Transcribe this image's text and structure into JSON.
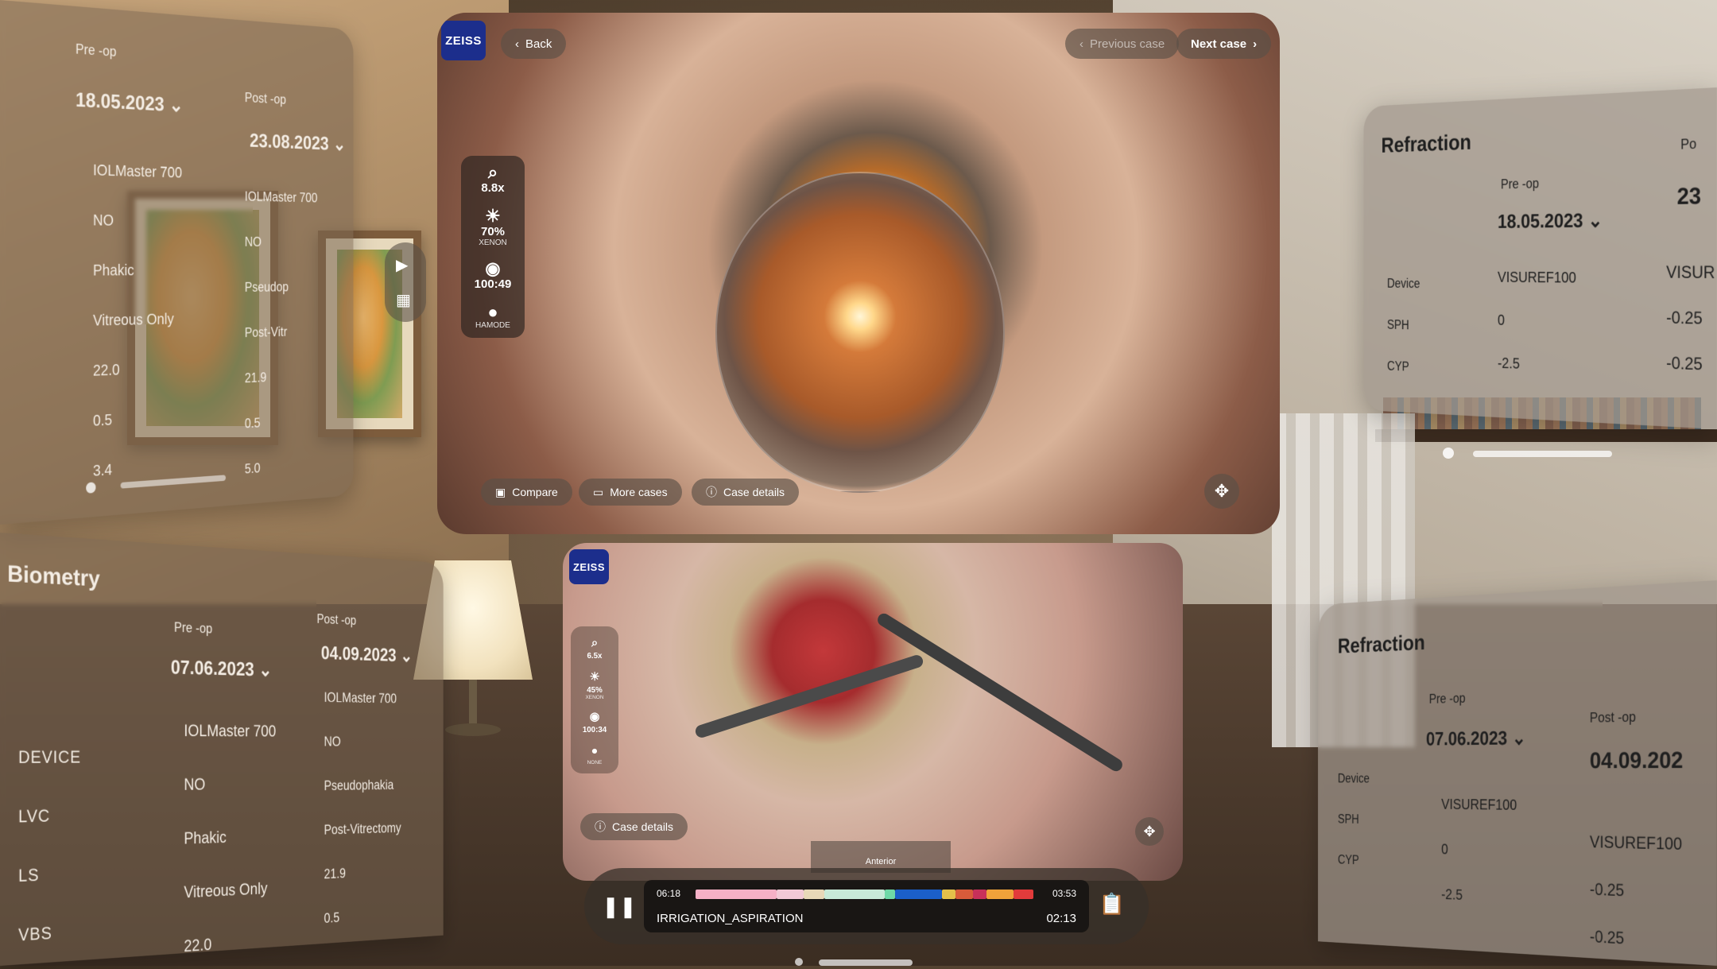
{
  "app": {
    "brand": "ZEISS"
  },
  "main_video": {
    "back_label": "Back",
    "prev_case_label": "Previous case",
    "next_case_label": "Next case",
    "tools": [
      {
        "value": "8.8x",
        "sub": "",
        "icon": "zoom-icon"
      },
      {
        "value": "70%",
        "sub": "XENON",
        "icon": "brightness-icon"
      },
      {
        "value": "100:49",
        "sub": "",
        "icon": "focus-icon"
      },
      {
        "value": "",
        "sub": "HAMODE",
        "icon": "mode-icon"
      }
    ],
    "compare_label": "Compare",
    "more_cases_label": "More cases",
    "case_details_label": "Case details"
  },
  "secondary_video": {
    "tools": [
      {
        "value": "6.5x",
        "sub": "",
        "icon": "zoom-icon"
      },
      {
        "value": "45%",
        "sub": "XENON",
        "icon": "brightness-icon"
      },
      {
        "value": "100:34",
        "sub": "",
        "icon": "focus-icon"
      },
      {
        "value": "",
        "sub": "NONE",
        "icon": "mode-icon"
      }
    ],
    "case_details_label": "Case details",
    "thumb_label": "Anterior"
  },
  "player": {
    "start_time": "06:18",
    "end_time": "03:53",
    "phase": "IRRIGATION_ASPIRATION",
    "elapsed": "02:13",
    "progress": 0.62
  },
  "left_panel": {
    "pre_label": "Pre -op",
    "pre_date": "18.05.2023",
    "post_label": "Post -op",
    "post_date": "23.08.2023",
    "pre_values": [
      "IOLMaster 700",
      "NO",
      "Phakic",
      "Vitreous Only",
      "22.0",
      "0.5",
      "3.4"
    ],
    "post_values": [
      "IOLMaster 700",
      "NO",
      "Pseudop",
      "Post-Vitr",
      "21.9",
      "0.5",
      "5.0"
    ]
  },
  "biometry": {
    "title": "Biometry",
    "pre_label": "Pre -op",
    "pre_date": "07.06.2023",
    "post_label": "Post -op",
    "post_date": "04.09.2023",
    "rows": [
      "DEVICE",
      "LVC",
      "LS",
      "VBS"
    ],
    "pre_values": [
      "IOLMaster 700",
      "NO",
      "Phakic",
      "Vitreous Only",
      "22.0"
    ],
    "post_values": [
      "IOLMaster 700",
      "NO",
      "Pseudophakia",
      "Post-Vitrectomy",
      "21.9",
      "0.5"
    ]
  },
  "refraction_top": {
    "title": "Refraction",
    "pre_label": "Pre -op",
    "pre_date": "18.05.2023",
    "post_label": "Po",
    "post_date": "23",
    "rows": [
      "Device",
      "SPH",
      "CYP"
    ],
    "pre_values": [
      "VISUREF100",
      "0",
      "-2.5"
    ],
    "post_values": [
      "VISUR",
      "-0.25",
      "-0.25"
    ]
  },
  "refraction_bottom": {
    "title": "Refraction",
    "pre_label": "Pre -op",
    "pre_date": "07.06.2023",
    "post_label": "Post -op",
    "post_date": "04.09.202",
    "rows": [
      "Device",
      "SPH",
      "CYP"
    ],
    "pre_values": [
      "VISUREF100",
      "0",
      "-2.5"
    ],
    "post_values": [
      "VISUREF100",
      "-0.25",
      "-0.25"
    ]
  }
}
